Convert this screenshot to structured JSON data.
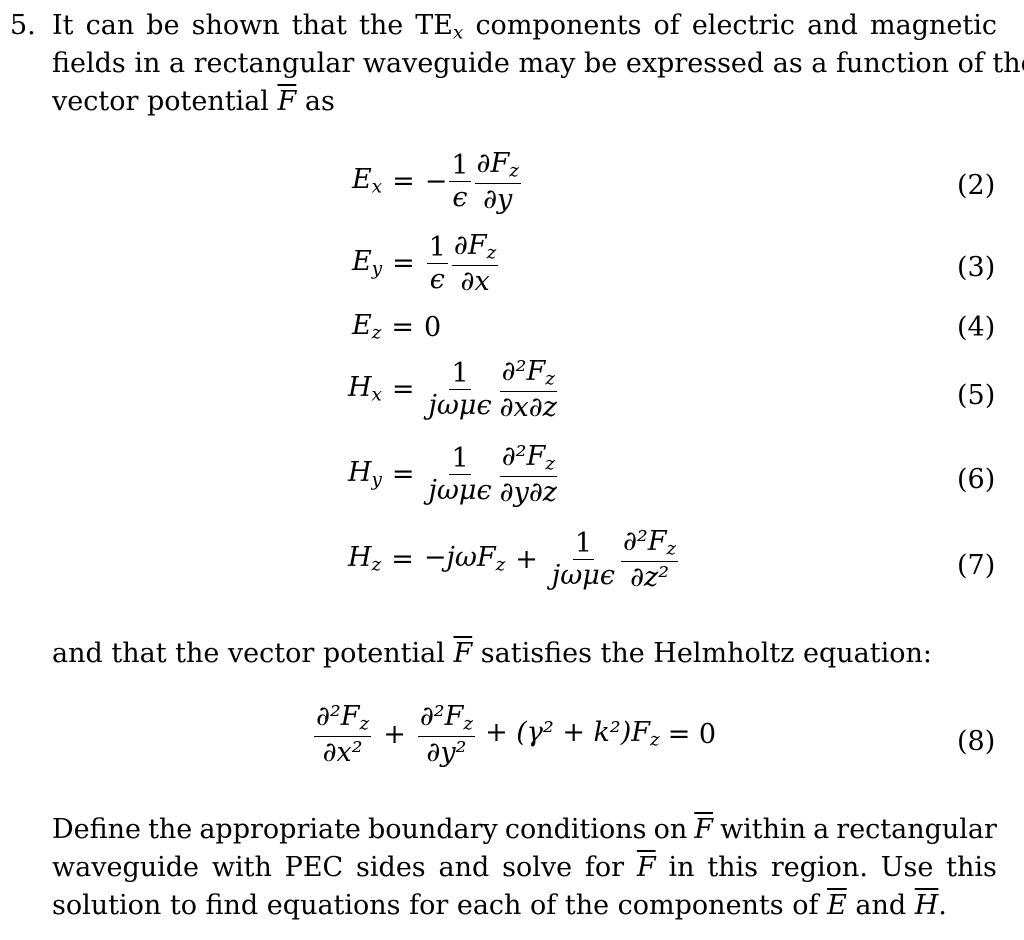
{
  "problem": {
    "number": "5.",
    "intro_line1": [
      "It",
      "can",
      "be",
      "shown",
      "that",
      "the",
      "TE",
      "components",
      "of",
      "electric",
      "and",
      "magnetic"
    ],
    "intro_sub": "x",
    "intro_line2": "fields in a rectangular waveguide may be expressed as a function of the",
    "intro_line3_a": "vector potential",
    "intro_line3_var": "F",
    "intro_line3_b": "as",
    "equations": [
      {
        "lhs": "E",
        "lhs_sub": "x",
        "sign": "−",
        "f1_num": "1",
        "f1_den": "ϵ",
        "f2_num": "∂F",
        "f2_num_sub": "z",
        "f2_den": "∂y",
        "tag": "(2)"
      },
      {
        "lhs": "E",
        "lhs_sub": "y",
        "sign": "",
        "f1_num": "1",
        "f1_den": "ϵ",
        "f2_num": "∂F",
        "f2_num_sub": "z",
        "f2_den": "∂x",
        "tag": "(3)"
      },
      {
        "lhs": "E",
        "lhs_sub": "z",
        "rhs": "0",
        "tag": "(4)"
      },
      {
        "lhs": "H",
        "lhs_sub": "x",
        "f1_num": "1",
        "f1_den": "jωμϵ",
        "f2_num": "∂²F",
        "f2_num_sub": "z",
        "f2_den": "∂x∂z",
        "tag": "(5)"
      },
      {
        "lhs": "H",
        "lhs_sub": "y",
        "f1_num": "1",
        "f1_den": "jωμϵ",
        "f2_num": "∂²F",
        "f2_num_sub": "z",
        "f2_den": "∂y∂z",
        "tag": "(6)"
      },
      {
        "lhs": "H",
        "lhs_sub": "z",
        "pre": "−jωF",
        "pre_sub": "z",
        "plus": "+",
        "f1_num": "1",
        "f1_den": "jωμϵ",
        "f2_num": "∂²F",
        "f2_num_sub": "z",
        "f2_den": "∂z²",
        "tag": "(7)"
      }
    ],
    "helmholtz_intro_a": "and that the vector potential",
    "helmholtz_intro_var": "F",
    "helmholtz_intro_b": "satisfies the Helmholtz equation:",
    "helmholtz": {
      "t1_num": "∂²F",
      "t1_sub": "z",
      "t1_den": "∂x²",
      "plus": "+",
      "t2_num": "∂²F",
      "t2_sub": "z",
      "t2_den": "∂y²",
      "rest": "+ (γ² + k²)F",
      "rest_sub": "z",
      "rhs": "= 0",
      "tag": "(8)"
    },
    "task_line1": [
      "Define",
      "the",
      "appropriate",
      "boundary",
      "conditions",
      "on",
      "F",
      "within",
      "a",
      "rectangular"
    ],
    "task_line2": [
      "waveguide",
      "with",
      "PEC",
      "sides",
      "and",
      "solve",
      "for",
      "F",
      "in",
      "this",
      "region.",
      "Use",
      "this"
    ],
    "task_line3_a": "solution to find equations for each of the components of",
    "task_line3_E": "E",
    "task_line3_and": "and",
    "task_line3_H": "H",
    "task_line3_end": "."
  }
}
